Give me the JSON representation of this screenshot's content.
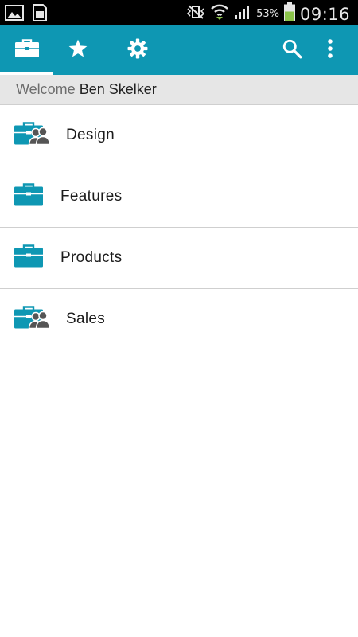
{
  "status_bar": {
    "battery_pct": "53%",
    "time": "09:16",
    "icons": [
      "gallery-icon",
      "sim-card-icon",
      "vibrate-icon",
      "wifi-icon",
      "signal-icon",
      "battery-icon"
    ]
  },
  "action_bar": {
    "tabs": [
      {
        "name": "workspaces",
        "icon": "briefcase-icon",
        "active": true
      },
      {
        "name": "favorites",
        "icon": "star-icon",
        "active": false
      },
      {
        "name": "settings",
        "icon": "gear-icon",
        "active": false
      }
    ],
    "actions": [
      "search-icon",
      "overflow-menu-icon"
    ],
    "color": "#0e97b3"
  },
  "welcome": {
    "prefix": "Welcome",
    "name": "Ben Skelker"
  },
  "items": [
    {
      "label": "Design",
      "icon": "shared-briefcase-icon"
    },
    {
      "label": "Features",
      "icon": "briefcase-icon"
    },
    {
      "label": "Products",
      "icon": "briefcase-icon"
    },
    {
      "label": "Sales",
      "icon": "shared-briefcase-icon"
    }
  ],
  "colors": {
    "accent": "#0e97b3",
    "people_icon": "#555555"
  }
}
